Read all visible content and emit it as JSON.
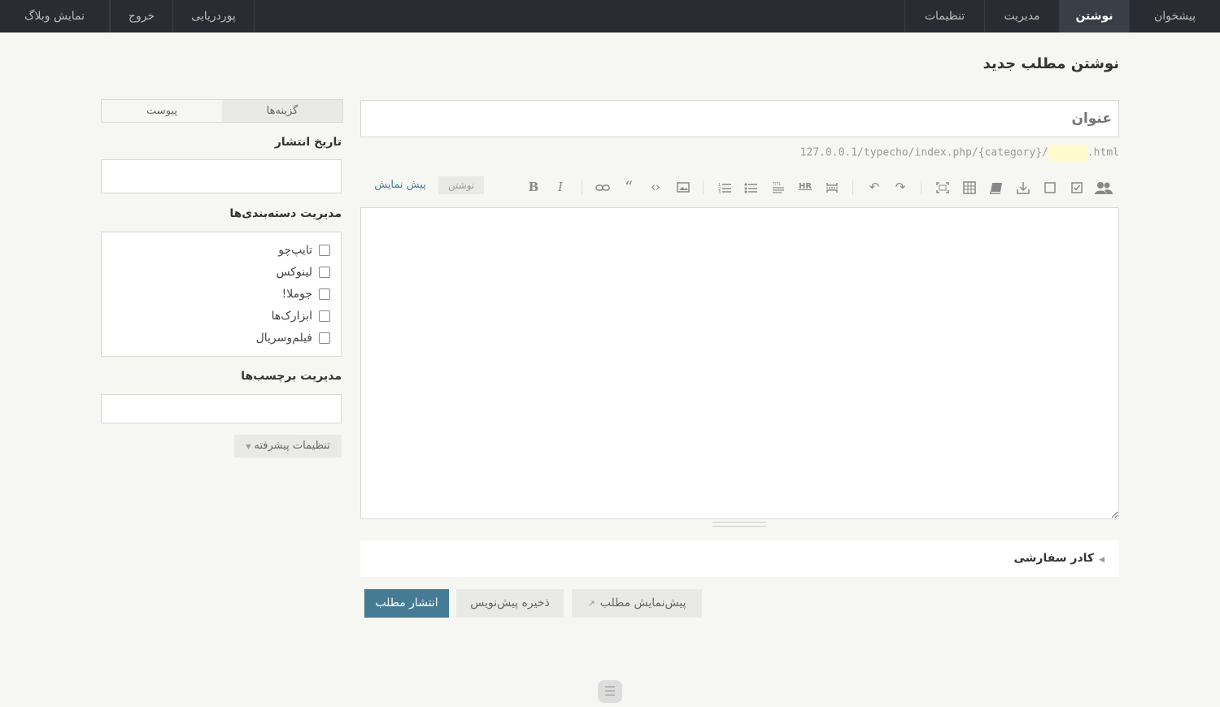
{
  "nav": {
    "items": [
      {
        "label": "پیشخوان",
        "active": false
      },
      {
        "label": "نوشتن",
        "active": true
      },
      {
        "label": "مدیریت",
        "active": false
      },
      {
        "label": "تنظیمات",
        "active": false
      }
    ],
    "right_items": [
      {
        "label": "پوردریایی"
      },
      {
        "label": "خروج"
      },
      {
        "label": "نمایش وبلاگ"
      }
    ]
  },
  "page": {
    "title": "نوشتن مطلب جدید"
  },
  "editor": {
    "title_placeholder": "عنوان",
    "permalink_prefix": "127.0.0.1/typecho/index.php/{category}/",
    "permalink_suffix": ".html",
    "mode_write": "نوشتن",
    "mode_preview": "پیش نمایش",
    "toolbar_icons": [
      "bold-icon",
      "italic-icon",
      "link-icon",
      "quote-icon",
      "code-icon",
      "image-icon",
      "ordered-list-icon",
      "unordered-list-icon",
      "title-icon",
      "hr-icon",
      "more-icon",
      "undo-icon",
      "redo-icon",
      "fullscreen-icon",
      "table-icon",
      "book-icon",
      "download-icon",
      "square-icon",
      "checkbox-icon",
      "users-icon"
    ]
  },
  "custom_fields": {
    "label": "کادر سفارشی"
  },
  "actions": {
    "publish": "انتشار مطلب",
    "save_draft": "ذخیره پیش‌نویس",
    "preview": "پیش‌نمایش مطلب"
  },
  "sidebar": {
    "tab_options": "گزینه‌ها",
    "tab_attachments": "پیوست",
    "date_label": "تاریخ انتشار",
    "categories_label": "مدیریت دسته‌بندی‌ها",
    "categories": [
      "تایپ‌چو",
      "لینوکس",
      "جوملا!",
      "ابزارک‌ها",
      "فیلم‌وسریال"
    ],
    "tags_label": "مدیریت برچسب‌ها",
    "advanced_label": "تنظیمات پیشرفته"
  },
  "colors": {
    "accent": "#467b96",
    "topbar": "#292d33",
    "background": "#f6f6f3"
  }
}
